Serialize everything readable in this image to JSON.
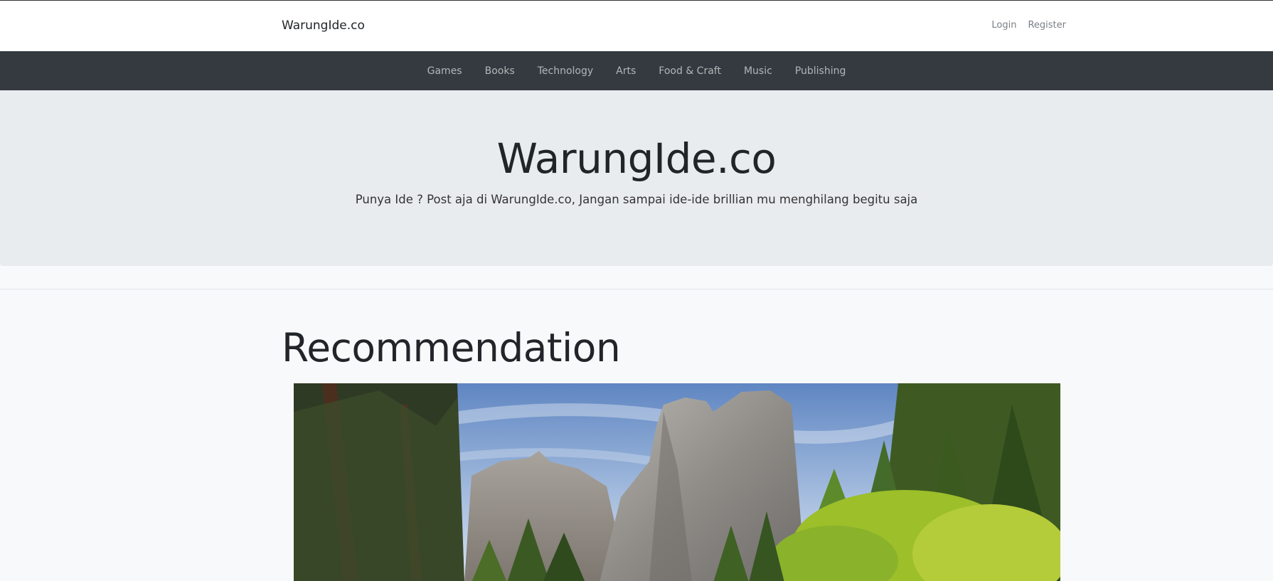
{
  "header": {
    "brand": "WarungIde.co",
    "login": "Login",
    "register": "Register"
  },
  "categories": [
    "Games",
    "Books",
    "Technology",
    "Arts",
    "Food & Craft",
    "Music",
    "Publishing"
  ],
  "jumbotron": {
    "title": "WarungIde.co",
    "tagline": "Punya Ide ? Post aja di WarungIde.co, Jangan sampai ide-ide brillian mu menghilang begitu saja"
  },
  "section": {
    "title": "Recommendation"
  },
  "colors": {
    "navbar_dark": "#343a40",
    "jumbotron_bg": "#e9ecef",
    "page_bg": "#f8f9fa"
  }
}
